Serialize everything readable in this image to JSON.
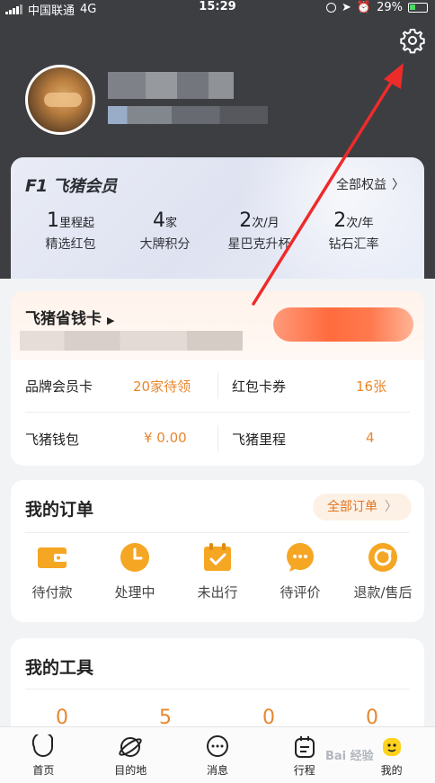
{
  "status_bar": {
    "carrier": "中国联通",
    "network": "4G",
    "time": "15:29",
    "battery": "29%"
  },
  "profile": {
    "settings_icon": "gear-icon"
  },
  "membership": {
    "badge": "F1",
    "title": "飞猪会员",
    "all_benefits": "全部权益",
    "benefits": [
      {
        "num": "1",
        "unit": "里程起",
        "label": "精选红包"
      },
      {
        "num": "4",
        "unit": "家",
        "label": "大牌积分"
      },
      {
        "num": "2",
        "unit": "次/月",
        "label": "星巴克升杯"
      },
      {
        "num": "2",
        "unit": "次/年",
        "label": "钻石汇率"
      }
    ]
  },
  "savings_card": {
    "title": "飞猪省钱卡",
    "stats": [
      {
        "label": "品牌会员卡",
        "value": "20家待领"
      },
      {
        "label": "红包卡券",
        "value": "16张"
      },
      {
        "label": "飞猪钱包",
        "value": "¥ 0.00"
      },
      {
        "label": "飞猪里程",
        "value": "4"
      }
    ]
  },
  "orders": {
    "title": "我的订单",
    "all_orders": "全部订单",
    "items": [
      {
        "label": "待付款",
        "icon": "wallet-icon"
      },
      {
        "label": "处理中",
        "icon": "clock-icon"
      },
      {
        "label": "未出行",
        "icon": "calendar-check-icon"
      },
      {
        "label": "待评价",
        "icon": "comment-icon"
      },
      {
        "label": "退款/售后",
        "icon": "refund-icon"
      }
    ]
  },
  "tools": {
    "title": "我的工具",
    "numbers": [
      "0",
      "5",
      "0",
      "0"
    ]
  },
  "tab_bar": [
    {
      "label": "首页",
      "icon": "home-icon"
    },
    {
      "label": "目的地",
      "icon": "planet-icon"
    },
    {
      "label": "消息",
      "icon": "message-icon"
    },
    {
      "label": "行程",
      "icon": "itinerary-icon"
    },
    {
      "label": "我的",
      "icon": "profile-icon"
    }
  ],
  "colors": {
    "header_bg": "#3c3e42",
    "accent_orange": "#e8872e",
    "annotation_red": "#ee2b2b"
  },
  "watermark": "Bai 经验"
}
